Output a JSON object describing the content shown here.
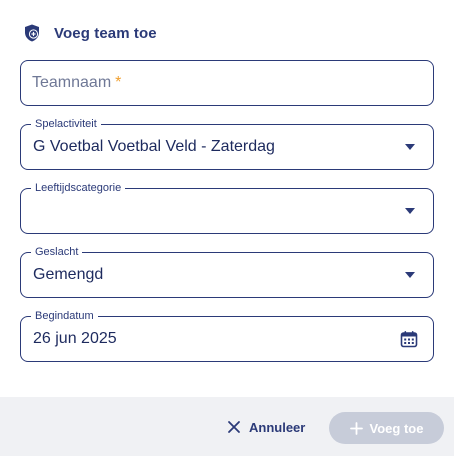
{
  "dialog": {
    "title": "Voeg team toe",
    "icon": "shield-plus-icon"
  },
  "form": {
    "teamname": {
      "placeholder": "Teamnaam",
      "required_marker": "*",
      "value": ""
    },
    "activity": {
      "label": "Spelactiviteit",
      "value": "G Voetbal Voetbal Veld - Zaterdag"
    },
    "age_category": {
      "label": "Leeftijdscategorie",
      "value": ""
    },
    "gender": {
      "label": "Geslacht",
      "value": "Gemengd"
    },
    "start_date": {
      "label": "Begindatum",
      "value": "26 jun 2025"
    }
  },
  "footer": {
    "cancel_label": "Annuleer",
    "add_label": "Voeg toe",
    "add_disabled": true
  },
  "colors": {
    "primary": "#2b3a78",
    "required": "#f0a030",
    "disabled_button": "#c7ccd9",
    "footer_bg": "#f0f1f4"
  }
}
